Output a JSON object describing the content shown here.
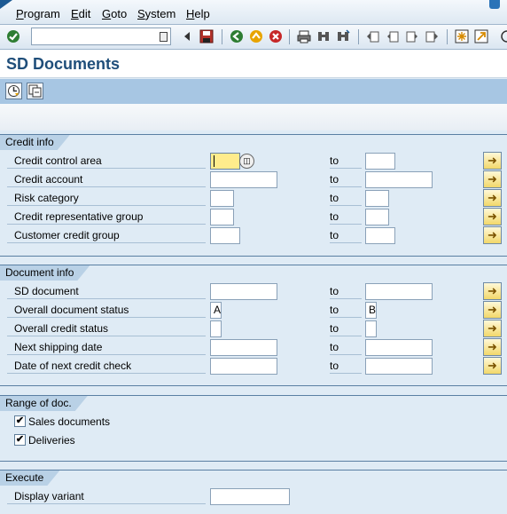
{
  "menu": {
    "items": [
      "Program",
      "Edit",
      "Goto",
      "System",
      "Help"
    ],
    "underline": [
      "P",
      "E",
      "G",
      "S",
      "H"
    ],
    "rest": [
      "rogram",
      "dit",
      "oto",
      "ystem",
      "elp"
    ]
  },
  "toolbar": {
    "command_value": "",
    "icons": [
      "enter-icon",
      "command-dropdown-icon",
      "back-arrow-icon",
      "save-icon",
      "back-icon",
      "exit-icon",
      "cancel-icon",
      "print-icon",
      "find-icon",
      "find-next-icon",
      "first-page-icon",
      "previous-page-icon",
      "next-page-icon",
      "last-page-icon",
      "new-session-icon",
      "shortcut-icon"
    ]
  },
  "title": "SD Documents",
  "sections": {
    "credit": {
      "label": "Credit info",
      "rows": [
        {
          "label": "Credit control area",
          "from": "",
          "to_label": "to",
          "to": ""
        },
        {
          "label": "Credit account",
          "from": "",
          "to_label": "to",
          "to": ""
        },
        {
          "label": "Risk category",
          "from": "",
          "to_label": "to",
          "to": ""
        },
        {
          "label": "Credit representative group",
          "from": "",
          "to_label": "to",
          "to": ""
        },
        {
          "label": "Customer credit group",
          "from": "",
          "to_label": "to",
          "to": ""
        }
      ]
    },
    "document": {
      "label": "Document info",
      "rows": [
        {
          "label": "SD document",
          "from": "",
          "to_label": "to",
          "to": ""
        },
        {
          "label": "Overall document status",
          "from": "A",
          "to_label": "to",
          "to": "B"
        },
        {
          "label": "Overall credit status",
          "from": "",
          "to_label": "to",
          "to": ""
        },
        {
          "label": "Next shipping date",
          "from": "",
          "to_label": "to",
          "to": ""
        },
        {
          "label": "Date of next credit check",
          "from": "",
          "to_label": "to",
          "to": ""
        }
      ]
    },
    "range": {
      "label": "Range of doc.",
      "items": [
        {
          "label": "Sales documents",
          "checked": true
        },
        {
          "label": "Deliveries",
          "checked": true
        }
      ]
    },
    "execute": {
      "label": "Execute",
      "display_variant_label": "Display variant",
      "display_variant_value": ""
    }
  },
  "colors": {
    "background": "#dfebf5",
    "title": "#1f4e7a",
    "focus_field": "#ffec8c",
    "app_toolbar": "#a7c6e3"
  }
}
